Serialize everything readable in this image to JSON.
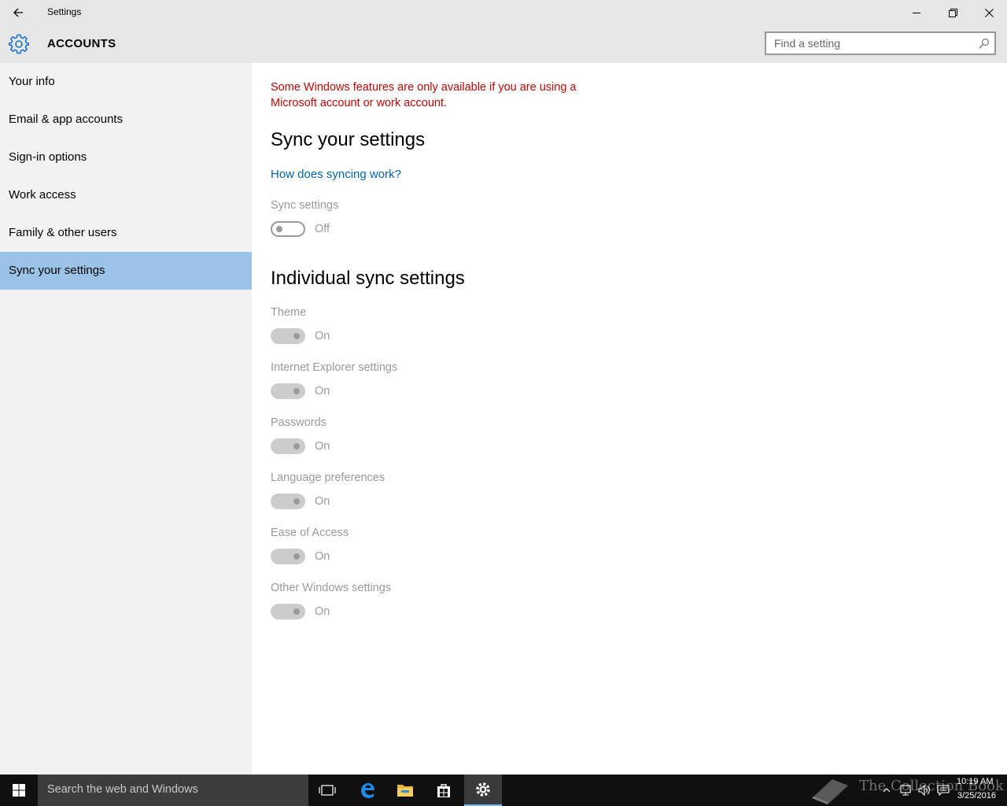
{
  "window": {
    "title": "Settings"
  },
  "header": {
    "section_title": "ACCOUNTS",
    "search_placeholder": "Find a setting"
  },
  "sidebar": {
    "items": [
      {
        "label": "Your info"
      },
      {
        "label": "Email & app accounts"
      },
      {
        "label": "Sign-in options"
      },
      {
        "label": "Work access"
      },
      {
        "label": "Family & other users"
      },
      {
        "label": "Sync your settings",
        "selected": true
      }
    ]
  },
  "main": {
    "warning": "Some Windows features are only available if you are using a Microsoft account or work account.",
    "heading": "Sync your settings",
    "help_link": "How does syncing work?",
    "sync_settings": {
      "label": "Sync settings",
      "state": "Off"
    },
    "individual_heading": "Individual sync settings",
    "individual": [
      {
        "label": "Theme",
        "state": "On"
      },
      {
        "label": "Internet Explorer settings",
        "state": "On"
      },
      {
        "label": "Passwords",
        "state": "On"
      },
      {
        "label": "Language preferences",
        "state": "On"
      },
      {
        "label": "Ease of Access",
        "state": "On"
      },
      {
        "label": "Other Windows settings",
        "state": "On"
      }
    ]
  },
  "taskbar": {
    "search_text": "Search the web and Windows",
    "watermark": "The Collection Book",
    "time": "10:19 AM",
    "date": "3/25/2016"
  },
  "colors": {
    "accent": "#0063b1",
    "selected_nav": "#99c3e7",
    "warning": "#c50500"
  }
}
